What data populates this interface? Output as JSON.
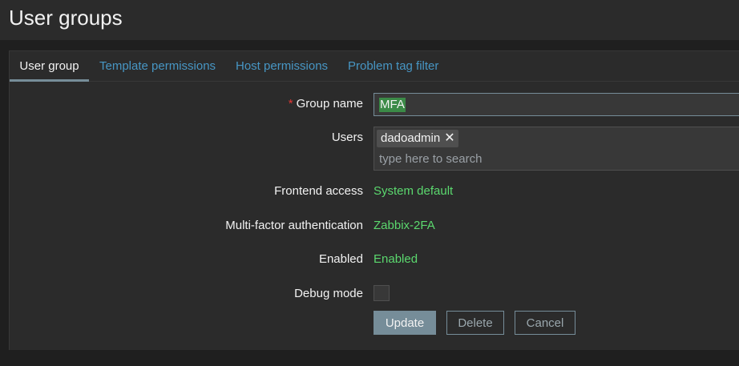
{
  "page": {
    "title": "User groups"
  },
  "tabs": [
    {
      "label": "User group",
      "active": true
    },
    {
      "label": "Template permissions"
    },
    {
      "label": "Host permissions"
    },
    {
      "label": "Problem tag filter"
    }
  ],
  "form": {
    "group_name": {
      "label": "Group name",
      "required_marker": "*",
      "value": "MFA"
    },
    "users": {
      "label": "Users",
      "selected": [
        "dadoadmin"
      ],
      "remove_glyph": "✕",
      "placeholder": "type here to search"
    },
    "frontend_access": {
      "label": "Frontend access",
      "value": "System default"
    },
    "mfa": {
      "label": "Multi-factor authentication",
      "value": "Zabbix-2FA"
    },
    "enabled": {
      "label": "Enabled",
      "value": "Enabled"
    },
    "debug_mode": {
      "label": "Debug mode",
      "checked": false
    }
  },
  "buttons": {
    "update": "Update",
    "delete": "Delete",
    "cancel": "Cancel"
  },
  "colors": {
    "background": "#1f1f1f",
    "panel": "#2b2b2b",
    "link": "#4796c4",
    "value_green": "#5bd86e",
    "required_red": "#e33734",
    "button_primary": "#768d99",
    "selection_green": "#3b8a47"
  }
}
